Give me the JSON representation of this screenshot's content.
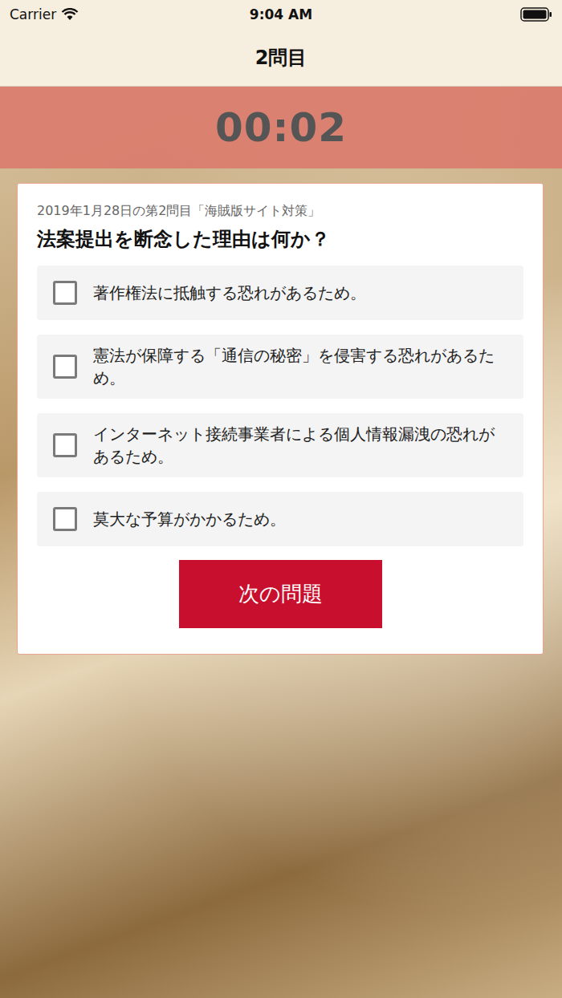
{
  "status_bar": {
    "carrier": "Carrier",
    "time": "9:04 AM"
  },
  "nav": {
    "title": "2問目"
  },
  "timer": "00:02",
  "card": {
    "subtitle": "2019年1月28日の第2問目「海賊版サイト対策」",
    "question": "法案提出を断念した理由は何か？",
    "options": [
      {
        "label": "著作権法に抵触する恐れがあるため。",
        "checked": false
      },
      {
        "label": "憲法が保障する「通信の秘密」を侵害する恐れがあるため。",
        "checked": false
      },
      {
        "label": "インターネット接続事業者による個人情報漏洩の恐れがあるため。",
        "checked": false
      },
      {
        "label": "莫大な予算がかかるため。",
        "checked": false
      }
    ],
    "button": "次の問題"
  }
}
